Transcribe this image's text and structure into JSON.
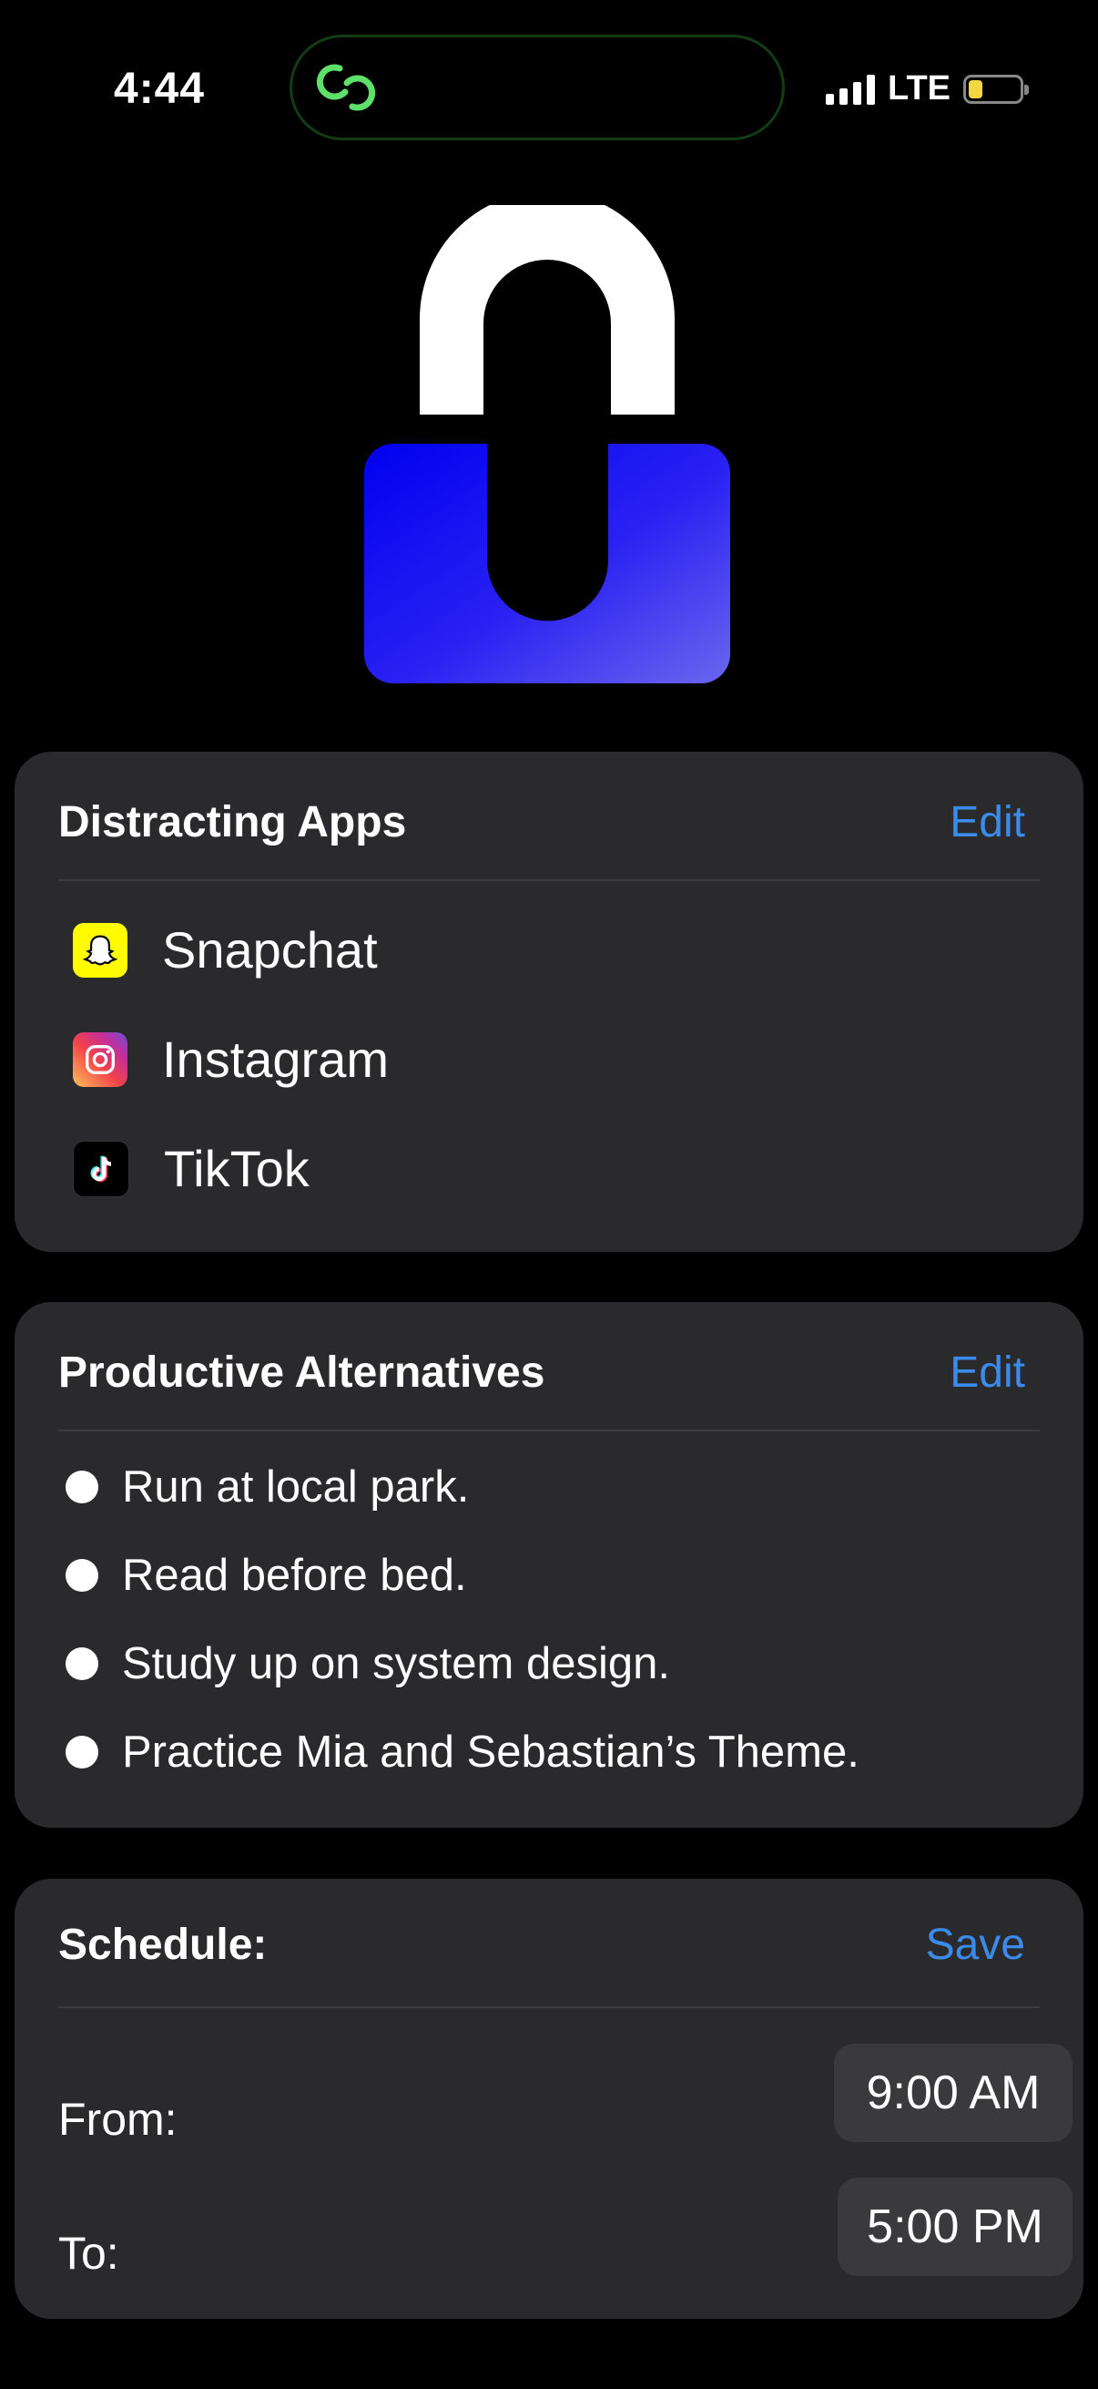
{
  "status": {
    "time": "4:44",
    "network": "LTE"
  },
  "distracting": {
    "title": "Distracting Apps",
    "action": "Edit",
    "apps": [
      {
        "name": "Snapchat",
        "icon": "snapchat-icon"
      },
      {
        "name": "Instagram",
        "icon": "instagram-icon"
      },
      {
        "name": "TikTok",
        "icon": "tiktok-icon"
      }
    ]
  },
  "alternatives": {
    "title": "Productive Alternatives",
    "action": "Edit",
    "items": [
      "Run at local park.",
      "Read before bed.",
      "Study up on system design.",
      "Practice Mia and Sebastian’s Theme."
    ]
  },
  "schedule": {
    "title": "Schedule:",
    "action": "Save",
    "from_label": "From:",
    "from_value": "9:00 AM",
    "to_label": "To:",
    "to_value": "5:00 PM"
  },
  "colors": {
    "accent": "#3b8beb",
    "card": "#2a2a2c",
    "lock_blue": "#1a12f5"
  }
}
